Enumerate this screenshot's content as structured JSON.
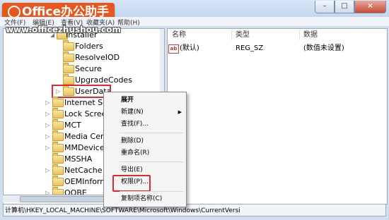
{
  "header": {
    "brand_logo": "Office办公助手",
    "watermark_url": "www.officezhushou.com"
  },
  "window_controls": {
    "minimize": "–",
    "maximize": "□",
    "close": "×"
  },
  "menubar": {
    "items": [
      "文件(F)",
      "编辑(E)",
      "查看(V)",
      "收藏夹(A)",
      "帮助(H)"
    ]
  },
  "tree": {
    "items": [
      {
        "label": "Installer",
        "level": 2,
        "expander": "◢"
      },
      {
        "label": "Folders",
        "level": 3,
        "expander": ""
      },
      {
        "label": "ResolveIOD",
        "level": 3,
        "expander": ""
      },
      {
        "label": "Secure",
        "level": 3,
        "expander": ""
      },
      {
        "label": "UpgradeCodes",
        "level": 3,
        "expander": ""
      },
      {
        "label": "UserData",
        "level": 3,
        "expander": "▷",
        "selected": true
      },
      {
        "label": "Internet Set",
        "level": 2,
        "expander": "▷"
      },
      {
        "label": "Lock Screen",
        "level": 2,
        "expander": "▷"
      },
      {
        "label": "MCT",
        "level": 2,
        "expander": "▷"
      },
      {
        "label": "Media Cent",
        "level": 2,
        "expander": "▷"
      },
      {
        "label": "MMDevices",
        "level": 2,
        "expander": "▷"
      },
      {
        "label": "MSSHA",
        "level": 2,
        "expander": ""
      },
      {
        "label": "NetCache",
        "level": 2,
        "expander": "▷"
      },
      {
        "label": "OEMInform",
        "level": 2,
        "expander": ""
      },
      {
        "label": "OOBE",
        "level": 2,
        "expander": "▷"
      }
    ]
  },
  "values_pane": {
    "columns": {
      "name": "名称",
      "type": "类型",
      "data": "数据"
    },
    "rows": [
      {
        "name": "(默认)",
        "type": "REG_SZ",
        "data": "(数值未设置)",
        "icon": "ab"
      }
    ]
  },
  "context_menu": {
    "items": [
      {
        "label": "展开",
        "bold": true
      },
      {
        "label": "新建(N)",
        "submenu": true
      },
      {
        "label": "查找(F)..."
      },
      {
        "label": "删除(D)"
      },
      {
        "label": "重命名(R)"
      },
      {
        "label": "导出(E)"
      },
      {
        "label": "权限(P)...",
        "highlighted": true
      },
      {
        "label": "复制项名称(C)"
      }
    ],
    "submenu_arrow": "▶"
  },
  "statusbar": {
    "path": "计算机\\HKEY_LOCAL_MACHINE\\SOFTWARE\\Microsoft\\Windows\\CurrentVersi"
  },
  "colors": {
    "highlight_red": "#e22a2a",
    "logo_orange": "#e8551d",
    "window_frame": "#cfdff0"
  }
}
